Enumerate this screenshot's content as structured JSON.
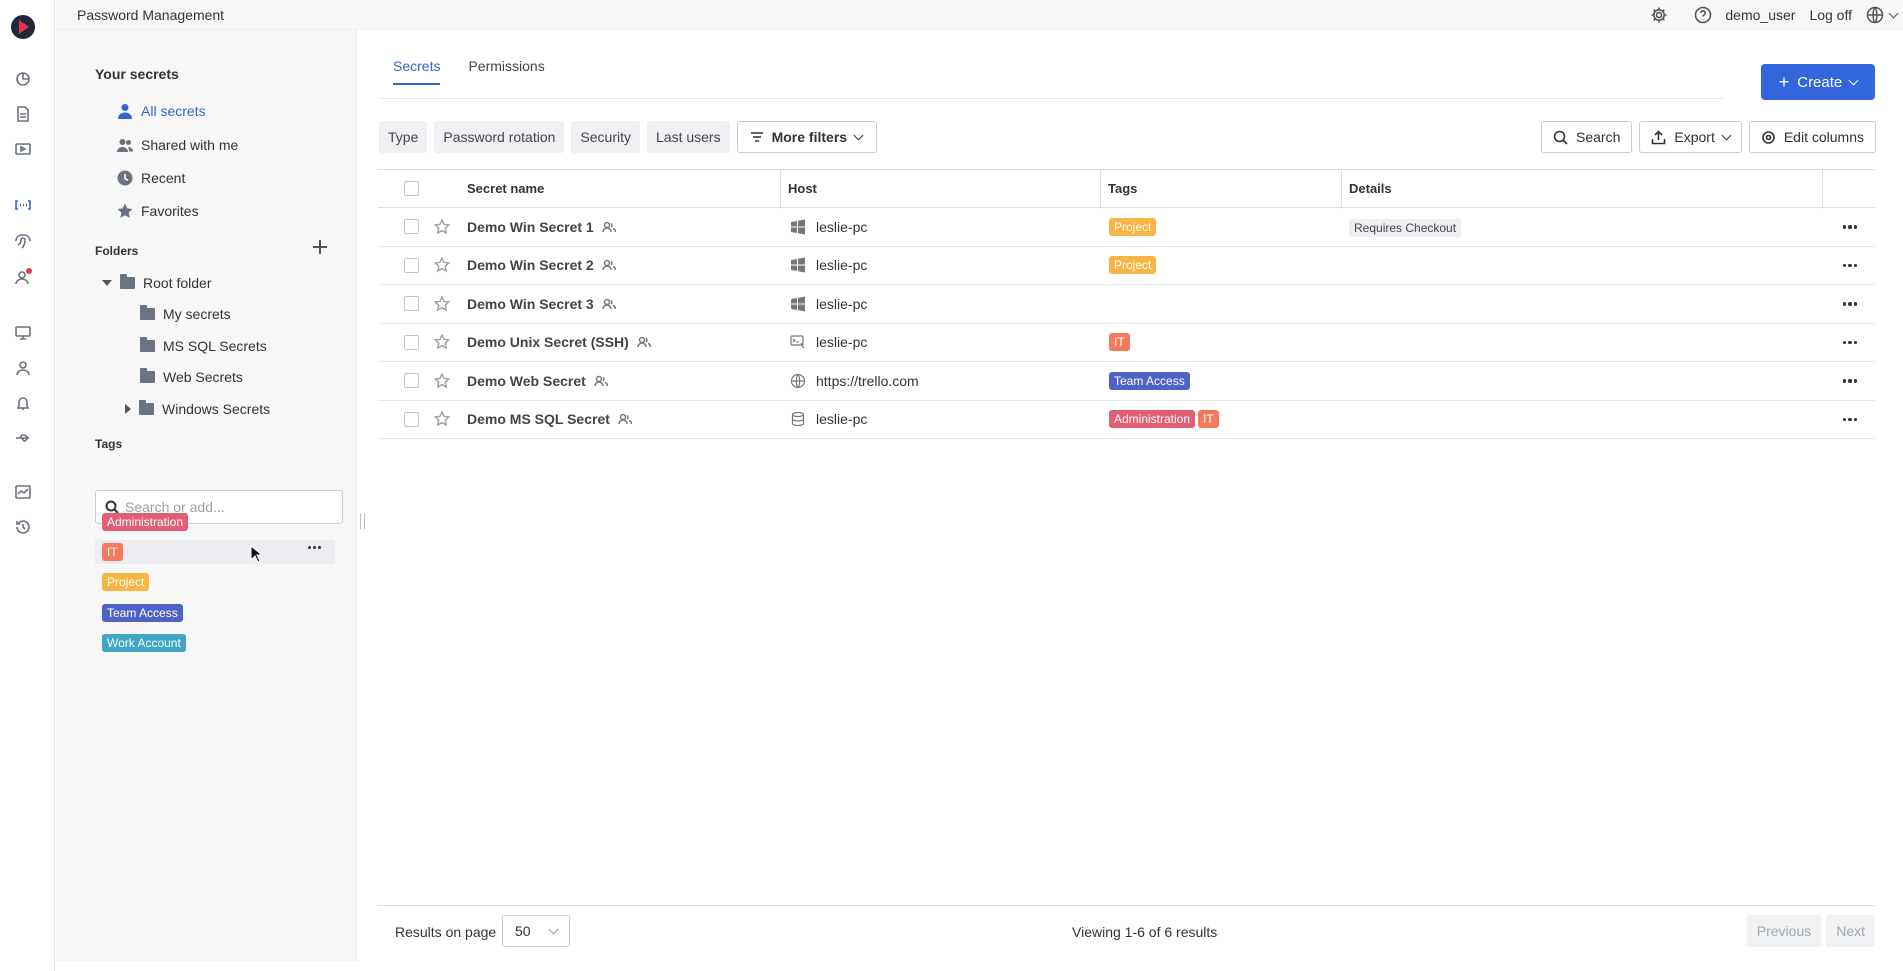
{
  "header": {
    "app_title": "Password Management",
    "username": "demo_user",
    "logoff": "Log off"
  },
  "sidebar": {
    "your_secrets_heading": "Your secrets",
    "nav": [
      {
        "label": "All secrets",
        "icon": "user-icon",
        "active": true
      },
      {
        "label": "Shared with me",
        "icon": "users-icon"
      },
      {
        "label": "Recent",
        "icon": "clock-icon"
      },
      {
        "label": "Favorites",
        "icon": "star-icon"
      }
    ],
    "folders_heading": "Folders",
    "folders": [
      {
        "label": "Root folder"
      },
      {
        "label": "My secrets"
      },
      {
        "label": "MS SQL Secrets"
      },
      {
        "label": "Web Secrets"
      },
      {
        "label": "Windows Secrets"
      }
    ],
    "tags_heading": "Tags",
    "tag_search_placeholder": "Search or add...",
    "tags": [
      {
        "label": "Administration",
        "color": "#e25e74"
      },
      {
        "label": "IT",
        "color": "#f47a5e"
      },
      {
        "label": "Project",
        "color": "#f6b544"
      },
      {
        "label": "Team Access",
        "color": "#4f63c4"
      },
      {
        "label": "Work Account",
        "color": "#3fa6c6"
      }
    ]
  },
  "main": {
    "tabs": [
      {
        "label": "Secrets",
        "active": true
      },
      {
        "label": "Permissions"
      }
    ],
    "create_label": "Create",
    "filters": [
      "Type",
      "Password rotation",
      "Security",
      "Last users"
    ],
    "more_filters": "More filters",
    "actions": {
      "search": "Search",
      "export": "Export",
      "edit_columns": "Edit columns"
    },
    "columns": [
      "Secret name",
      "Host",
      "Tags",
      "Details"
    ],
    "rows": [
      {
        "name": "Demo Win Secret 1",
        "host": "leslie-pc",
        "host_icon": "windows-icon",
        "tags": [
          "Project"
        ],
        "details": "Requires Checkout"
      },
      {
        "name": "Demo Win Secret 2",
        "host": "leslie-pc",
        "host_icon": "windows-icon",
        "tags": [
          "Project"
        ],
        "details": ""
      },
      {
        "name": "Demo Win Secret 3",
        "host": "leslie-pc",
        "host_icon": "windows-icon",
        "tags": [],
        "details": ""
      },
      {
        "name": "Demo Unix Secret (SSH)",
        "host": "leslie-pc",
        "host_icon": "ssh-terminal-icon",
        "tags": [
          "IT"
        ],
        "details": ""
      },
      {
        "name": "Demo Web Secret",
        "host": "https://trello.com",
        "host_icon": "globe-icon",
        "tags": [
          "Team Access"
        ],
        "details": ""
      },
      {
        "name": "Demo MS SQL Secret",
        "host": "leslie-pc",
        "host_icon": "database-icon",
        "tags": [
          "Administration",
          "IT"
        ],
        "details": ""
      }
    ]
  },
  "footer": {
    "results_label": "Results on page",
    "page_size": "50",
    "viewing": "Viewing 1-6 of 6 results",
    "previous": "Previous",
    "next": "Next"
  },
  "colors": {
    "accent": "#3366dd",
    "tag_administration": "#e25e74",
    "tag_it": "#f47a5e",
    "tag_project": "#f6b544",
    "tag_team_access": "#4f63c4",
    "tag_work_account": "#3fa6c6"
  }
}
